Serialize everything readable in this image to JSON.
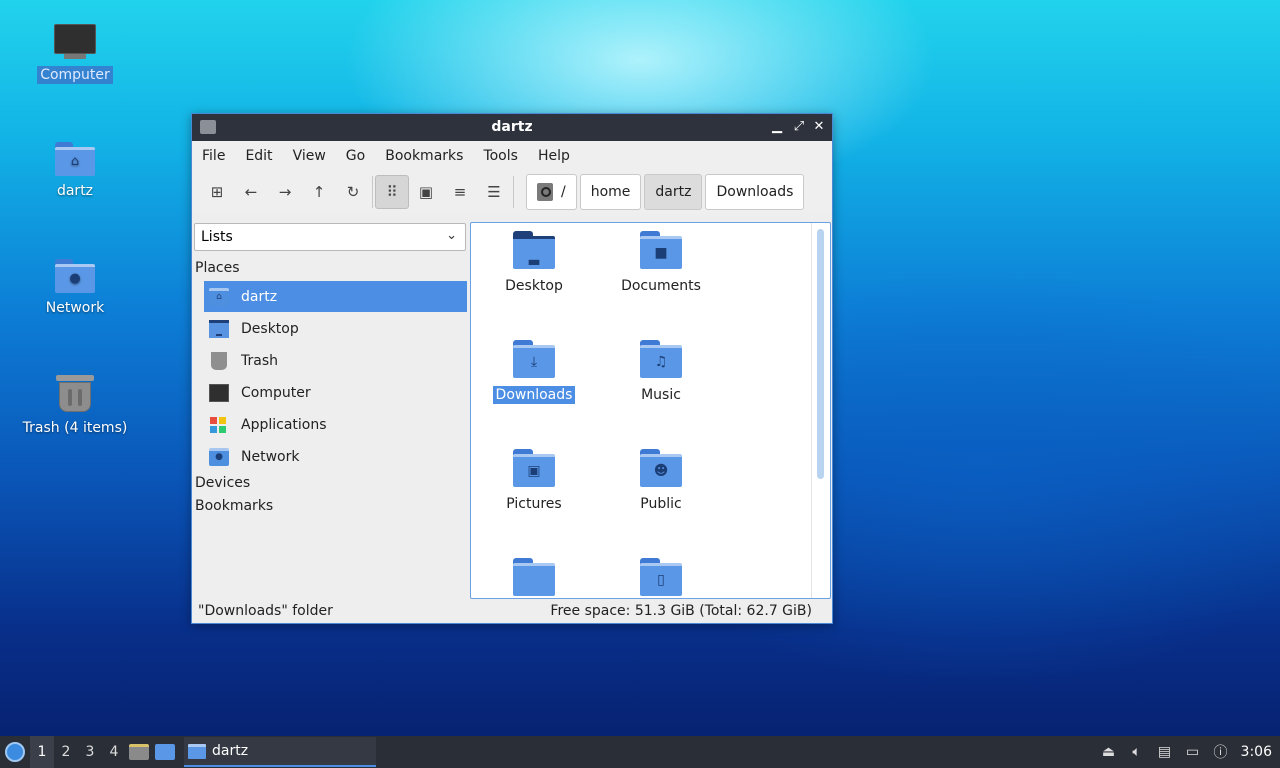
{
  "desktop": {
    "icons": [
      {
        "label": "Computer"
      },
      {
        "label": "dartz"
      },
      {
        "label": "Network"
      },
      {
        "label": "Trash (4 items)"
      }
    ]
  },
  "window": {
    "title": "dartz",
    "menu": [
      "File",
      "Edit",
      "View",
      "Go",
      "Bookmarks",
      "Tools",
      "Help"
    ],
    "path": {
      "root": "/",
      "crumbs": [
        "home",
        "dartz",
        "Downloads"
      ]
    },
    "side_select": "Lists",
    "sections": {
      "places": "Places",
      "devices": "Devices",
      "bookmarks": "Bookmarks"
    },
    "places": [
      "dartz",
      "Desktop",
      "Trash",
      "Computer",
      "Applications",
      "Network"
    ],
    "items": [
      "Desktop",
      "Documents",
      "Downloads",
      "Music",
      "Pictures",
      "Public",
      "",
      ""
    ],
    "status_left": "\"Downloads\" folder",
    "status_right": "Free space: 51.3 GiB (Total: 62.7 GiB)"
  },
  "taskbar": {
    "workspaces": [
      "1",
      "2",
      "3",
      "4"
    ],
    "task_label": "dartz",
    "clock": "3:06"
  },
  "colors": {
    "accent": "#4c8ee3",
    "folder": "#5a97e6",
    "titlebar": "#2d323c",
    "taskbar": "#2a2e36"
  }
}
